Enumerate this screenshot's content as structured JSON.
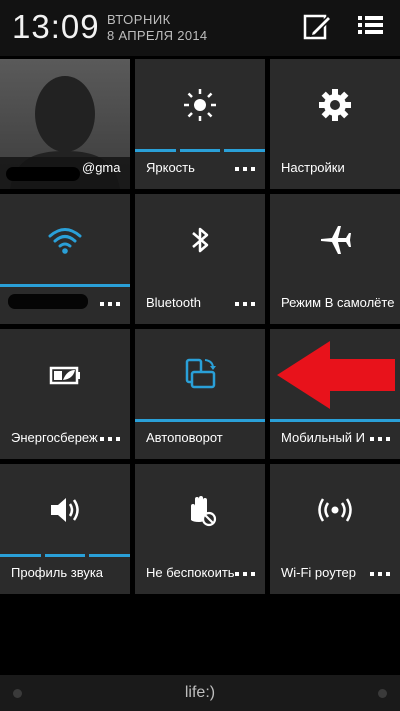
{
  "status": {
    "time": "13:09",
    "day": "ВТОРНИК",
    "date": "8 АПРЕЛЯ 2014"
  },
  "header_icons": [
    "edit-icon",
    "list-menu-icon"
  ],
  "tiles": [
    {
      "label": "@gma",
      "icon": "contact-photo",
      "menu": true
    },
    {
      "label": "Яркость",
      "icon": "brightness-icon",
      "menu": true
    },
    {
      "label": "Настройки",
      "icon": "gear-icon",
      "menu": false
    },
    {
      "label": "",
      "icon": "wifi-icon",
      "menu": true
    },
    {
      "label": "Bluetooth",
      "icon": "bluetooth-icon",
      "menu": true
    },
    {
      "label": "Режим В самолёте",
      "icon": "airplane-icon",
      "menu": false
    },
    {
      "label": "Энергосбереж",
      "icon": "battery-saver-icon",
      "menu": true
    },
    {
      "label": "Автоповорот",
      "icon": "auto-rotate-icon",
      "menu": false
    },
    {
      "label": "Мобильный И",
      "icon": "mobile-data-icon",
      "menu": true
    },
    {
      "label": "Профиль звука",
      "icon": "volume-icon",
      "menu": false
    },
    {
      "label": "Не беспокоить",
      "icon": "do-not-disturb-icon",
      "menu": true
    },
    {
      "label": "Wi-Fi роутер",
      "icon": "wifi-hotspot-icon",
      "menu": true
    }
  ],
  "bottom": {
    "carrier": "life:)"
  },
  "colors": {
    "accent": "#2aa0d8",
    "tile": "#2b2b2b",
    "background": "#000000",
    "arrow": "#e8121b"
  }
}
